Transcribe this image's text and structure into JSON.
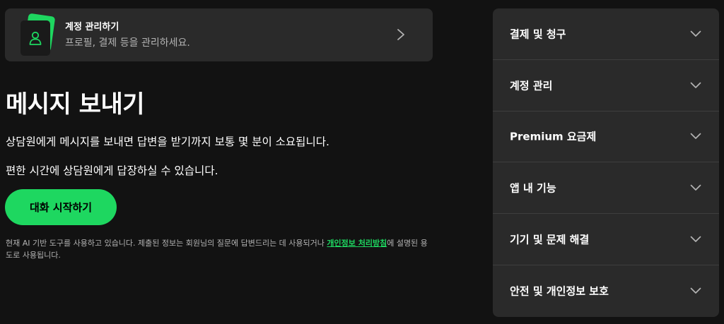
{
  "colors": {
    "background": "#121212",
    "card": "#2a2a2a",
    "accent": "#1ed760",
    "muted_text": "#b3b3b3"
  },
  "account_card": {
    "title": "계정 관리하기",
    "subtitle": "프로필, 결제 등을 관리하세요.",
    "icon": "user-card-icon",
    "chevron_icon": "chevron-right-icon"
  },
  "main": {
    "title": "메시지 보내기",
    "description_1": "상담원에게 메시지를 보내면 답변을 받기까지 보통 몇 분이 소요됩니다.",
    "description_2": "편한 시간에 상담원에게 답장하실 수 있습니다.",
    "chat_button": "대화 시작하기",
    "disclaimer_before": "현재 AI 기반 도구를 사용하고 있습니다. 제출된 정보는 회원님의 질문에 답변드리는 데 사용되거나 ",
    "disclaimer_link": "개인정보 처리방침",
    "disclaimer_after": "에 설명된 용도로 사용됩니다."
  },
  "faq": {
    "chevron_icon": "chevron-down-icon",
    "items": [
      {
        "label": "결제 및 청구"
      },
      {
        "label": "계정 관리"
      },
      {
        "label": "Premium 요금제"
      },
      {
        "label": "앱 내 기능"
      },
      {
        "label": "기기 및 문제 해결"
      },
      {
        "label": "안전 및 개인정보 보호"
      }
    ]
  }
}
